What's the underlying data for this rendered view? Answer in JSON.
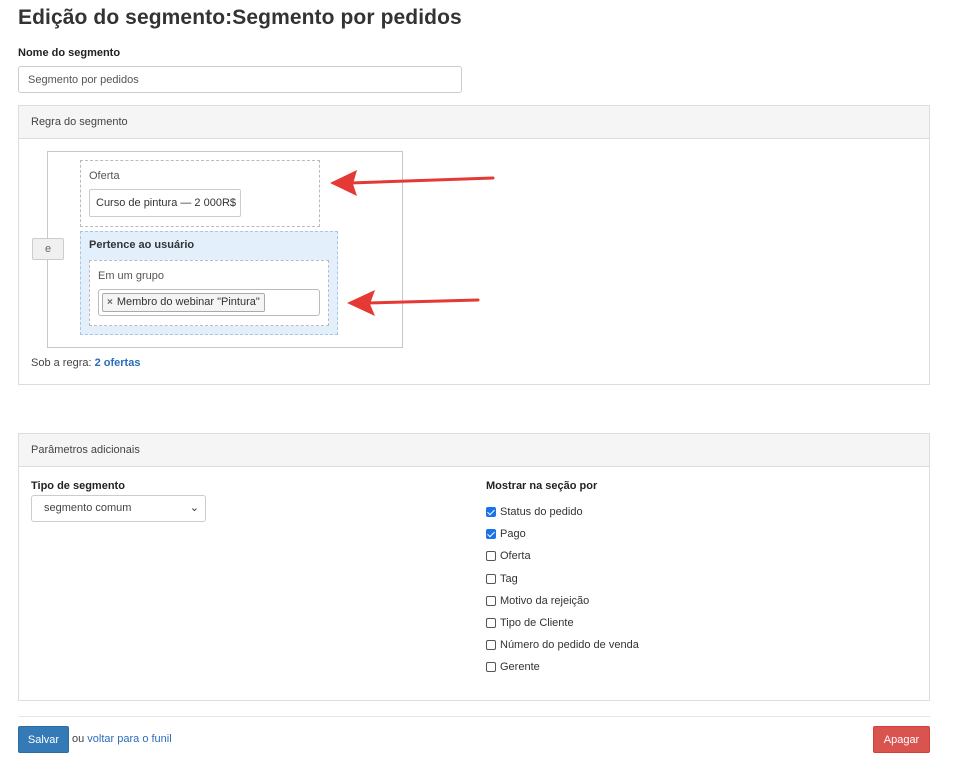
{
  "page": {
    "title": "Edição do segmento:Segmento por pedidos"
  },
  "segment_name": {
    "label": "Nome do segmento",
    "value": "Segmento por pedidos"
  },
  "rule_panel": {
    "heading": "Regra do segmento",
    "operator_label": "e",
    "offer_condition": {
      "title": "Oferta",
      "value": "Curso de pintura — 2 000R$"
    },
    "user_condition": {
      "title": "Pertence ao usuário",
      "group_title": "Em um grupo",
      "tag_remove": "×",
      "tag": "Membro do webinar \"Pintura\""
    },
    "under_rule_prefix": "Sob a regra: ",
    "under_rule_link": "2 ofertas"
  },
  "params_panel": {
    "heading": "Parâmetros adicionais",
    "segment_type": {
      "label": "Tipo de segmento",
      "value": "segmento comum"
    },
    "show_by": {
      "label": "Mostrar na seção por",
      "options": [
        {
          "label": "Status do pedido",
          "checked": true
        },
        {
          "label": "Pago",
          "checked": true
        },
        {
          "label": "Oferta",
          "checked": false
        },
        {
          "label": "Tag",
          "checked": false
        },
        {
          "label": "Motivo da rejeição",
          "checked": false
        },
        {
          "label": "Tipo de Cliente",
          "checked": false
        },
        {
          "label": "Número do pedido de venda",
          "checked": false
        },
        {
          "label": "Gerente",
          "checked": false
        }
      ]
    }
  },
  "footer": {
    "save_label": "Salvar",
    "or_text": "ou ",
    "back_link": "voltar para o funil",
    "delete_label": "Apagar"
  },
  "colors": {
    "primary": "#337ab7",
    "danger": "#d9534f",
    "annotation_arrow": "#e53935",
    "highlight_bg": "#e3effb"
  }
}
